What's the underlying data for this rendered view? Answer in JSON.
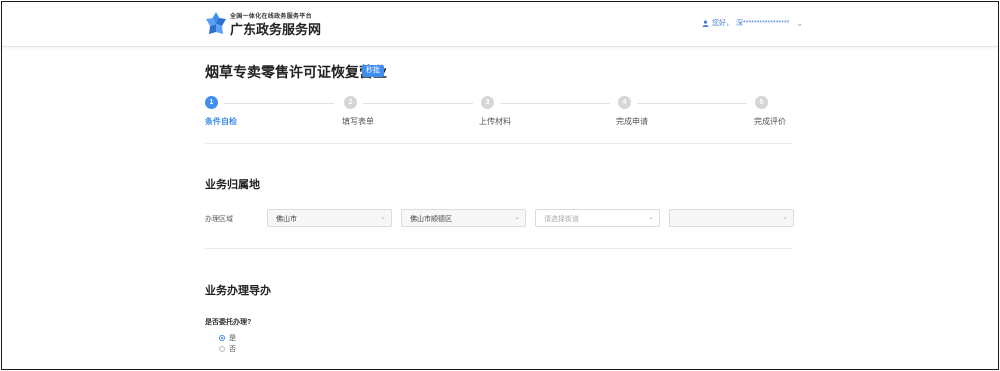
{
  "header": {
    "brand_sub": "全国一体化在线政务服务平台",
    "brand_main": "广东政务服务网",
    "user_greeting": "您好，",
    "user_name": "深*****************"
  },
  "page": {
    "title": "烟草专卖零售许可证恢复营业",
    "badge": "秒批"
  },
  "steps": [
    {
      "num": "1",
      "label": "条件自检",
      "active": true
    },
    {
      "num": "2",
      "label": "填写表单",
      "active": false
    },
    {
      "num": "3",
      "label": "上传材料",
      "active": false
    },
    {
      "num": "4",
      "label": "完成申请",
      "active": false
    },
    {
      "num": "5",
      "label": "完成评价",
      "active": false
    }
  ],
  "location": {
    "section_title": "业务归属地",
    "field_label": "办理区域",
    "city": "佛山市",
    "district": "佛山市顺德区",
    "street_placeholder": "请选择街道",
    "extra": ""
  },
  "guide": {
    "section_title": "业务办理导办",
    "question": "是否委托办理?",
    "options": [
      {
        "label": "是",
        "selected": true
      },
      {
        "label": "否",
        "selected": false
      }
    ]
  },
  "colors": {
    "accent": "#3f8ef0",
    "inactive_step": "#d6d6d6"
  }
}
